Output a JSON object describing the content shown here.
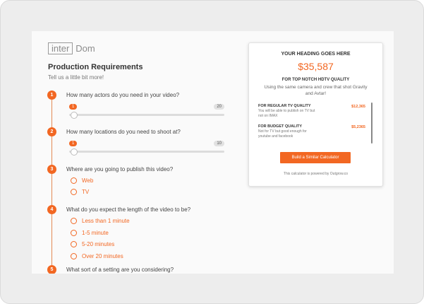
{
  "brand": {
    "logo_box": "inter",
    "logo_text": "Dom"
  },
  "form": {
    "title": "Production Requirements",
    "subtitle": "Tell us a little bit more!",
    "questions": [
      {
        "number": "1",
        "text": "How many actors do you need in your video?",
        "slider_min": "1",
        "slider_max": "20"
      },
      {
        "number": "2",
        "text": "How many locations do you need to shoot at?",
        "slider_min": "1",
        "slider_max": "10"
      },
      {
        "number": "3",
        "text": "Where are you going to publish this video?",
        "options": [
          "Web",
          "TV"
        ]
      },
      {
        "number": "4",
        "text": "What do you expect the length of the video to be?",
        "options": [
          "Less than 1 minute",
          "1-5 minute",
          "5-20 minutes",
          "Over 20 minutes"
        ]
      },
      {
        "number": "5",
        "text": "What sort of a setting are you considering?"
      }
    ]
  },
  "result_card": {
    "heading": "YOUR HEADING GOES HERE",
    "amount": "$35,587",
    "subheading": "FOR TOP NOTCH HDTV QUALITY",
    "description": "Using the same camera and crew that shot Gravity and Avtar!",
    "items": [
      {
        "title": "FOR REGULAR TV QUALITY",
        "description": "You will be able to publish on TV but not on IMAX",
        "value": "$12,365"
      },
      {
        "title": "FOR BUDGET QUALITY",
        "description": "Not for TV but good enough for youtube and facebook",
        "value": "$5,2365"
      }
    ],
    "cta_label": "Build a Similar Calculator",
    "powered_by": "This calculator is powered by Outgrow.co"
  },
  "colors": {
    "accent": "#f26722",
    "background": "#ededed",
    "panel": "#fafafa"
  }
}
